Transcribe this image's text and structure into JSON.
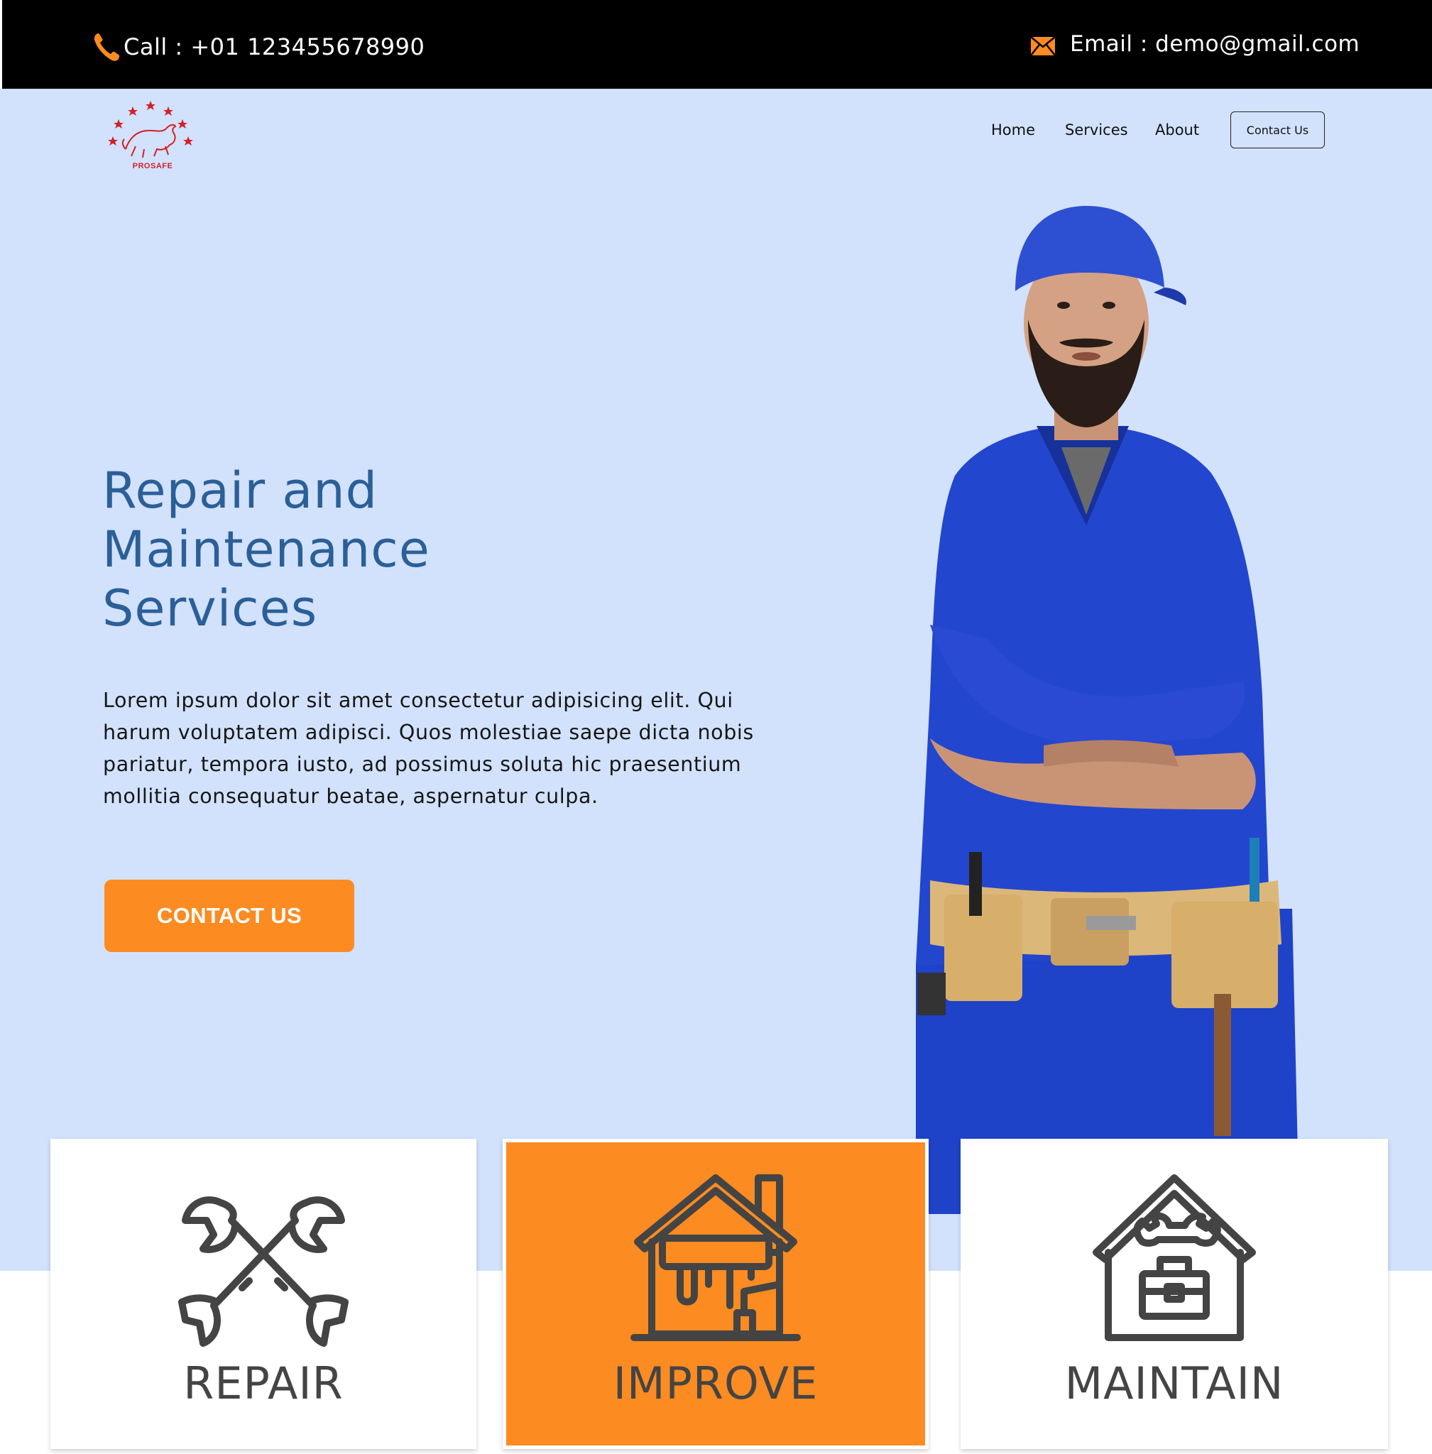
{
  "topbar": {
    "call_text": "Call : +01  123455678990",
    "email_text": "Email : demo@gmail.com",
    "icons": [
      "phone-icon",
      "envelope-icon"
    ],
    "accent_color": "#fc8b21"
  },
  "brand": {
    "logo_text": "PROSAFE",
    "logo_color": "#d31f26"
  },
  "nav": {
    "home": "Home",
    "services": "Services",
    "about": "About",
    "contact": "Contact Us"
  },
  "hero": {
    "headline_lines": [
      "Repair and",
      "Maintenance",
      "Services"
    ],
    "body": "Lorem ipsum dolor sit amet consectetur adipisicing elit. Qui harum voluptatem adipisci. Quos molestiae saepe dicta nobis pariatur, tempora iusto, ad possimus soluta hic praesentium mollitia consequatur beatae, aspernatur culpa.",
    "cta": "CONTACT US",
    "background_color": "#d2e2fc",
    "headline_color": "#2b5f98"
  },
  "cards": [
    {
      "label": "REPAIR",
      "icon": "crossed-wrenches-icon",
      "highlighted": false
    },
    {
      "label": "IMPROVE",
      "icon": "house-paint-roller-icon",
      "highlighted": true
    },
    {
      "label": "MAINTAIN",
      "icon": "house-toolbox-icon",
      "highlighted": false
    }
  ]
}
